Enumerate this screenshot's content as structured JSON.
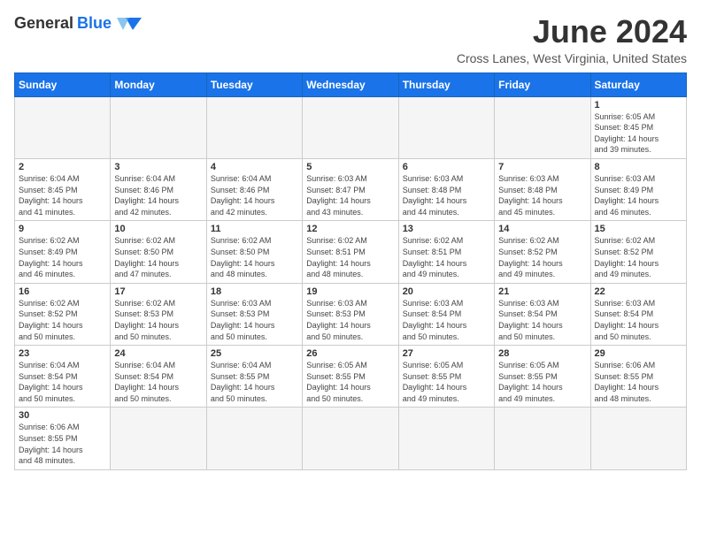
{
  "header": {
    "logo_general": "General",
    "logo_blue": "Blue",
    "month_title": "June 2024",
    "subtitle": "Cross Lanes, West Virginia, United States"
  },
  "days_of_week": [
    "Sunday",
    "Monday",
    "Tuesday",
    "Wednesday",
    "Thursday",
    "Friday",
    "Saturday"
  ],
  "weeks": [
    [
      {
        "day": "",
        "info": ""
      },
      {
        "day": "",
        "info": ""
      },
      {
        "day": "",
        "info": ""
      },
      {
        "day": "",
        "info": ""
      },
      {
        "day": "",
        "info": ""
      },
      {
        "day": "",
        "info": ""
      },
      {
        "day": "1",
        "info": "Sunrise: 6:05 AM\nSunset: 8:45 PM\nDaylight: 14 hours\nand 39 minutes."
      }
    ],
    [
      {
        "day": "2",
        "info": "Sunrise: 6:04 AM\nSunset: 8:45 PM\nDaylight: 14 hours\nand 41 minutes."
      },
      {
        "day": "3",
        "info": "Sunrise: 6:04 AM\nSunset: 8:46 PM\nDaylight: 14 hours\nand 42 minutes."
      },
      {
        "day": "4",
        "info": "Sunrise: 6:04 AM\nSunset: 8:46 PM\nDaylight: 14 hours\nand 42 minutes."
      },
      {
        "day": "5",
        "info": "Sunrise: 6:03 AM\nSunset: 8:47 PM\nDaylight: 14 hours\nand 43 minutes."
      },
      {
        "day": "6",
        "info": "Sunrise: 6:03 AM\nSunset: 8:48 PM\nDaylight: 14 hours\nand 44 minutes."
      },
      {
        "day": "7",
        "info": "Sunrise: 6:03 AM\nSunset: 8:48 PM\nDaylight: 14 hours\nand 45 minutes."
      },
      {
        "day": "8",
        "info": "Sunrise: 6:03 AM\nSunset: 8:49 PM\nDaylight: 14 hours\nand 46 minutes."
      }
    ],
    [
      {
        "day": "9",
        "info": "Sunrise: 6:02 AM\nSunset: 8:49 PM\nDaylight: 14 hours\nand 46 minutes."
      },
      {
        "day": "10",
        "info": "Sunrise: 6:02 AM\nSunset: 8:50 PM\nDaylight: 14 hours\nand 47 minutes."
      },
      {
        "day": "11",
        "info": "Sunrise: 6:02 AM\nSunset: 8:50 PM\nDaylight: 14 hours\nand 48 minutes."
      },
      {
        "day": "12",
        "info": "Sunrise: 6:02 AM\nSunset: 8:51 PM\nDaylight: 14 hours\nand 48 minutes."
      },
      {
        "day": "13",
        "info": "Sunrise: 6:02 AM\nSunset: 8:51 PM\nDaylight: 14 hours\nand 49 minutes."
      },
      {
        "day": "14",
        "info": "Sunrise: 6:02 AM\nSunset: 8:52 PM\nDaylight: 14 hours\nand 49 minutes."
      },
      {
        "day": "15",
        "info": "Sunrise: 6:02 AM\nSunset: 8:52 PM\nDaylight: 14 hours\nand 49 minutes."
      }
    ],
    [
      {
        "day": "16",
        "info": "Sunrise: 6:02 AM\nSunset: 8:52 PM\nDaylight: 14 hours\nand 50 minutes."
      },
      {
        "day": "17",
        "info": "Sunrise: 6:02 AM\nSunset: 8:53 PM\nDaylight: 14 hours\nand 50 minutes."
      },
      {
        "day": "18",
        "info": "Sunrise: 6:03 AM\nSunset: 8:53 PM\nDaylight: 14 hours\nand 50 minutes."
      },
      {
        "day": "19",
        "info": "Sunrise: 6:03 AM\nSunset: 8:53 PM\nDaylight: 14 hours\nand 50 minutes."
      },
      {
        "day": "20",
        "info": "Sunrise: 6:03 AM\nSunset: 8:54 PM\nDaylight: 14 hours\nand 50 minutes."
      },
      {
        "day": "21",
        "info": "Sunrise: 6:03 AM\nSunset: 8:54 PM\nDaylight: 14 hours\nand 50 minutes."
      },
      {
        "day": "22",
        "info": "Sunrise: 6:03 AM\nSunset: 8:54 PM\nDaylight: 14 hours\nand 50 minutes."
      }
    ],
    [
      {
        "day": "23",
        "info": "Sunrise: 6:04 AM\nSunset: 8:54 PM\nDaylight: 14 hours\nand 50 minutes."
      },
      {
        "day": "24",
        "info": "Sunrise: 6:04 AM\nSunset: 8:54 PM\nDaylight: 14 hours\nand 50 minutes."
      },
      {
        "day": "25",
        "info": "Sunrise: 6:04 AM\nSunset: 8:55 PM\nDaylight: 14 hours\nand 50 minutes."
      },
      {
        "day": "26",
        "info": "Sunrise: 6:05 AM\nSunset: 8:55 PM\nDaylight: 14 hours\nand 50 minutes."
      },
      {
        "day": "27",
        "info": "Sunrise: 6:05 AM\nSunset: 8:55 PM\nDaylight: 14 hours\nand 49 minutes."
      },
      {
        "day": "28",
        "info": "Sunrise: 6:05 AM\nSunset: 8:55 PM\nDaylight: 14 hours\nand 49 minutes."
      },
      {
        "day": "29",
        "info": "Sunrise: 6:06 AM\nSunset: 8:55 PM\nDaylight: 14 hours\nand 48 minutes."
      }
    ],
    [
      {
        "day": "30",
        "info": "Sunrise: 6:06 AM\nSunset: 8:55 PM\nDaylight: 14 hours\nand 48 minutes."
      },
      {
        "day": "",
        "info": ""
      },
      {
        "day": "",
        "info": ""
      },
      {
        "day": "",
        "info": ""
      },
      {
        "day": "",
        "info": ""
      },
      {
        "day": "",
        "info": ""
      },
      {
        "day": "",
        "info": ""
      }
    ]
  ]
}
